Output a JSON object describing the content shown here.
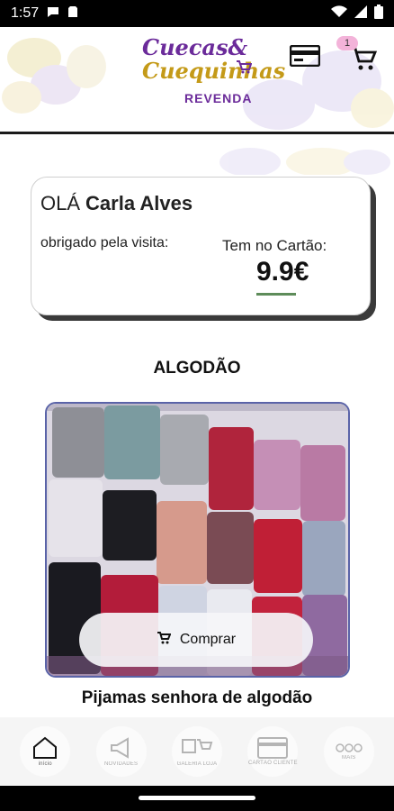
{
  "status_bar": {
    "time": "1:57"
  },
  "header": {
    "logo_line1": "Cuecas&",
    "logo_line2": "Cuequinhas",
    "logo_sub": "REVENDA",
    "cart_count": "1"
  },
  "greeting": {
    "hello": "OLÁ",
    "name": "Carla Alves",
    "thanks": "obrigado pela visita:",
    "balance_label": "Tem no Cartão:",
    "balance_value": "9.9€"
  },
  "section": {
    "title": "ALGODÃO"
  },
  "product": {
    "buy_label": "Comprar",
    "title": "Pijamas senhora de algodão"
  },
  "bottom_nav": {
    "items": [
      {
        "label": "início",
        "icon": "home-icon"
      },
      {
        "label": "NOVIDADES",
        "icon": "megaphone-icon"
      },
      {
        "label": "GALERIA LOJA",
        "icon": "gallery-cart-icon"
      },
      {
        "label": "CARTÃO CLIENTE",
        "icon": "credit-card-icon"
      },
      {
        "label": "MAIS",
        "icon": "more-icon"
      }
    ]
  },
  "colors": {
    "brand_purple": "#6b2b9a",
    "brand_gold": "#c49a18",
    "accent_green": "#5e8c5a",
    "badge_pink": "#f3b3d9"
  }
}
